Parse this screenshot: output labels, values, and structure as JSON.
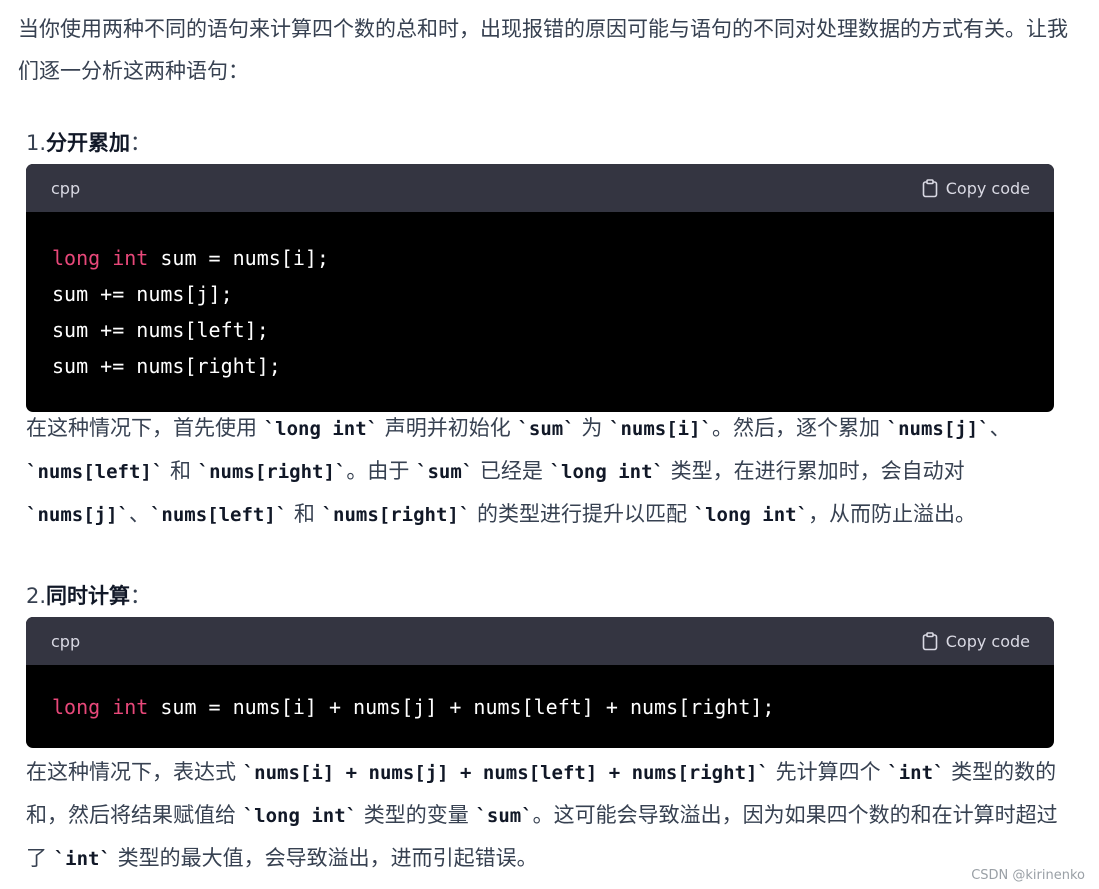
{
  "intro": "当你使用两种不同的语句来计算四个数的总和时，出现报错的原因可能与语句的不同对处理数据的方式有关。让我们逐一分析这两种语句：",
  "section1": {
    "num": "1.",
    "title": "分开累加",
    "colon": "：",
    "code": {
      "lang": "cpp",
      "copy": "Copy code",
      "lines": [
        {
          "kw": "long int",
          "rest": " sum = nums[i];"
        },
        {
          "kw": "",
          "rest": "sum += nums[j];"
        },
        {
          "kw": "",
          "rest": "sum += nums[left];"
        },
        {
          "kw": "",
          "rest": "sum += nums[right];"
        }
      ]
    },
    "explain": [
      {
        "text": "在这种情况下，首先使用 "
      },
      {
        "code": "`long int`"
      },
      {
        "text": " 声明并初始化 "
      },
      {
        "code": "`sum`"
      },
      {
        "text": " 为 "
      },
      {
        "code": "`nums[i]`"
      },
      {
        "text": "。然后，逐个累加 "
      },
      {
        "code": "`nums[j]`"
      },
      {
        "text": "、"
      },
      {
        "code": "`nums[left]`"
      },
      {
        "text": " 和 "
      },
      {
        "code": "`nums[right]`"
      },
      {
        "text": "。由于 "
      },
      {
        "code": "`sum`"
      },
      {
        "text": " 已经是 "
      },
      {
        "code": "`long int`"
      },
      {
        "text": " 类型，在进行累加时，会自动对 "
      },
      {
        "code": "`nums[j]`"
      },
      {
        "text": "、"
      },
      {
        "code": "`nums[left]`"
      },
      {
        "text": " 和 "
      },
      {
        "code": "`nums[right]`"
      },
      {
        "text": " 的类型进行提升以匹配 "
      },
      {
        "code": "`long int`"
      },
      {
        "text": "，从而防止溢出。"
      }
    ]
  },
  "section2": {
    "num": "2.",
    "title": "同时计算",
    "colon": "：",
    "code": {
      "lang": "cpp",
      "copy": "Copy code",
      "lines": [
        {
          "kw": "long int",
          "rest": " sum = nums[i] + nums[j] + nums[left] + nums[right];"
        }
      ]
    },
    "explain": [
      {
        "text": "在这种情况下，表达式 "
      },
      {
        "code": "`nums[i] + nums[j] + nums[left] + nums[right]`"
      },
      {
        "text": " 先计算四个 "
      },
      {
        "code": "`int`"
      },
      {
        "text": " 类型的数的和，然后将结果赋值给 "
      },
      {
        "code": "`long int`"
      },
      {
        "text": " 类型的变量 "
      },
      {
        "code": "`sum`"
      },
      {
        "text": "。这可能会导致溢出，因为如果四个数的和在计算时超过了 "
      },
      {
        "code": "`int`"
      },
      {
        "text": " 类型的最大值，会导致溢出，进而引起错误。"
      }
    ]
  },
  "watermark": "CSDN @kirinenko",
  "icons": {
    "copy": "clipboard-icon"
  },
  "colors": {
    "keyword": "#e8487a",
    "code_bg": "#000000",
    "code_header": "#343541"
  }
}
